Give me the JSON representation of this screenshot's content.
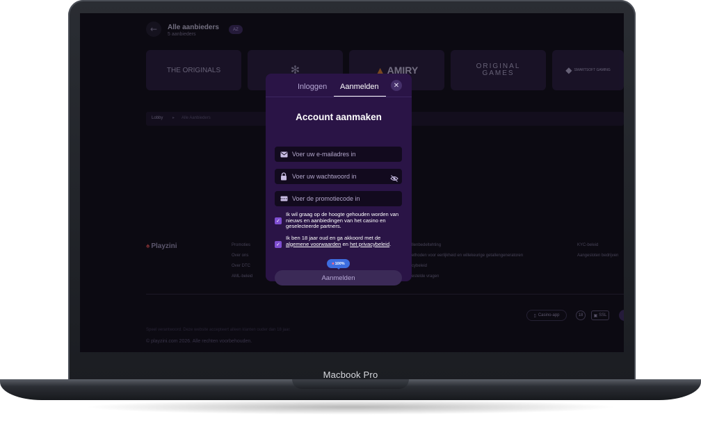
{
  "device": {
    "label": "Macbook Pro"
  },
  "background": {
    "header": {
      "title": "Alle aanbieders",
      "subtitle": "5 aanbieders",
      "sort_label": "AZ"
    },
    "providers": [
      "THE ORIGINALS",
      "",
      "AMIRY",
      "ORIGINAL GAMES",
      "SMARTSOFT GAMING"
    ],
    "breadcrumb": [
      "Lobby",
      "Alle Aanbieders"
    ],
    "footer": {
      "brand": "Playzini",
      "col1": [
        "Promoties",
        "Over ons",
        "Over DTC",
        "AML-beleid"
      ],
      "col2": [
        "llenbedeltehting",
        "ethoden voor eerlijkheid en willekeurige getallengeneratoren",
        "cybeleid",
        "estelde vragen"
      ],
      "col3": [
        "KYC-beleid",
        "Aangesloten bedrijven"
      ],
      "badges": {
        "app": "Casino-app",
        "age": "18",
        "ssl": "SSL"
      },
      "disclaimer": "Speel verantwoord. Deze website accepteert alleen klanten ouder dan 18 jaar.",
      "copyright": "© playzini.com 2026. Alle rechten voorbehouden."
    }
  },
  "modal": {
    "tabs": {
      "login": "Inloggen",
      "signup": "Aanmelden"
    },
    "active_tab": "signup",
    "title": "Account aanmaken",
    "fields": {
      "email": {
        "placeholder": "Voer uw e-mailadres in",
        "value": "",
        "icon": "mail-icon"
      },
      "password": {
        "placeholder": "Voer uw wachtwoord in",
        "value": "",
        "icon": "lock-icon"
      },
      "promo": {
        "placeholder": "Voer de promotiecode in",
        "value": "",
        "icon": "promo-ticket-icon"
      }
    },
    "checkboxes": {
      "news": {
        "checked": true,
        "text": "Ik wil graag op de hoogte gehouden worden van nieuws en aanbiedingen van het casino en geselecteerde partners."
      },
      "terms": {
        "checked": true,
        "text_prefix": "Ik ben 18 jaar oud en ga akkoord met de",
        "link1": "algemene voorwaarden",
        "conj": "en",
        "link2": "het privacybeleid",
        "suffix": "."
      }
    },
    "bonus_badge": "100%",
    "submit_label": "Aanmelden",
    "colors": {
      "modal_bg": "#2a1446",
      "accent": "#7e4ed1",
      "bonus": "#3d6de0"
    }
  }
}
